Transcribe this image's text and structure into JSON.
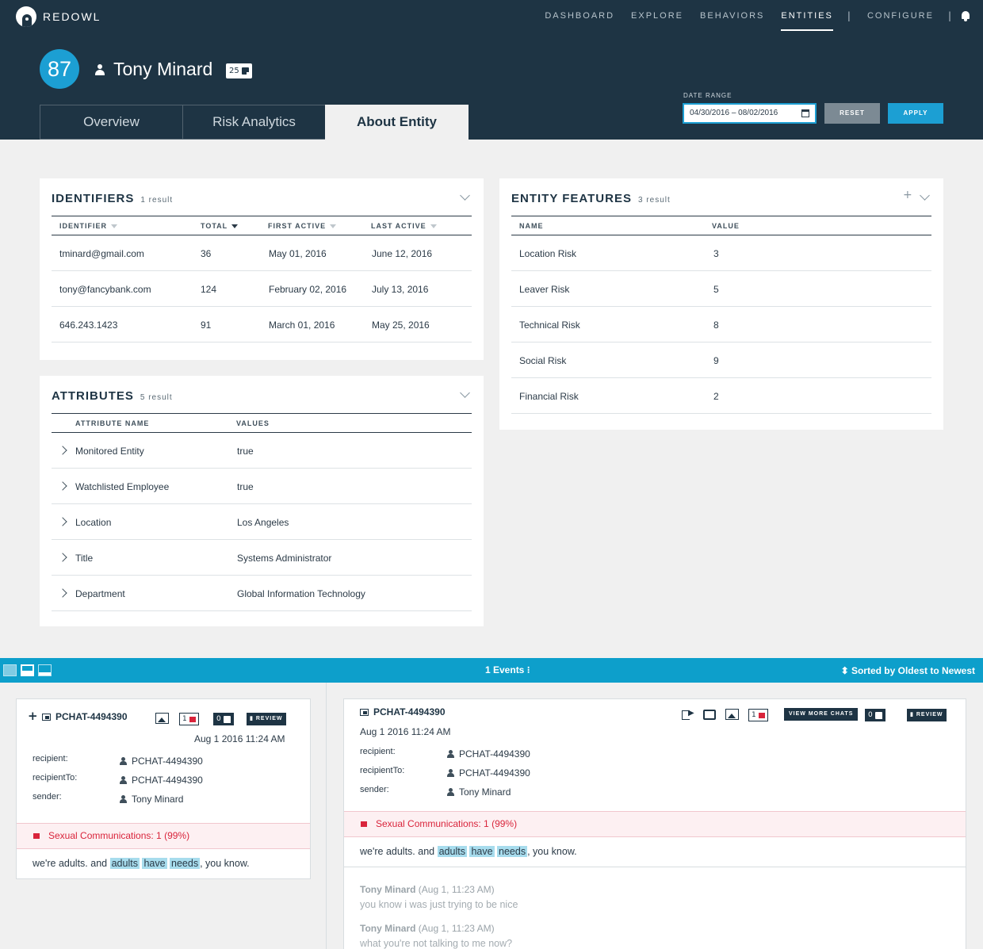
{
  "app": {
    "brand": "REDOWL"
  },
  "nav": {
    "items": [
      "DASHBOARD",
      "EXPLORE",
      "BEHAVIORS",
      "ENTITIES",
      "CONFIGURE"
    ],
    "active": "ENTITIES",
    "separator": "|"
  },
  "entity": {
    "score": "87",
    "name": "Tony Minard",
    "notes_count": "25"
  },
  "tabs": [
    "Overview",
    "Risk Analytics",
    "About Entity"
  ],
  "date_range": {
    "label": "DATE RANGE",
    "value": "04/30/2016 – 08/02/2016",
    "reset": "RESET",
    "apply": "APPLY"
  },
  "identifiers": {
    "title": "IDENTIFIERS",
    "count": "1 result",
    "columns": [
      "IDENTIFIER",
      "TOTAL",
      "FIRST ACTIVE",
      "LAST ACTIVE"
    ],
    "rows": [
      [
        "tminard@gmail.com",
        "36",
        "May 01, 2016",
        "June 12, 2016"
      ],
      [
        "tony@fancybank.com",
        "124",
        "February 02, 2016",
        "July 13, 2016"
      ],
      [
        "646.243.1423",
        "91",
        "March 01, 2016",
        "May 25, 2016"
      ]
    ]
  },
  "attributes": {
    "title": "ATTRIBUTES",
    "count": "5 result",
    "columns": [
      "ATTRIBUTE NAME",
      "VALUES"
    ],
    "rows": [
      [
        "Monitored Entity",
        "true"
      ],
      [
        "Watchlisted Employee",
        "true"
      ],
      [
        "Location",
        "Los Angeles"
      ],
      [
        "Title",
        "Systems Administrator"
      ],
      [
        "Department",
        "Global Information Technology"
      ]
    ]
  },
  "features": {
    "title": "ENTITY FEATURES",
    "count": "3 result",
    "columns": [
      "NAME",
      "VALUE"
    ],
    "rows": [
      [
        "Location Risk",
        "3"
      ],
      [
        "Leaver Risk",
        "5"
      ],
      [
        "Technical Risk",
        "8"
      ],
      [
        "Social Risk",
        "9"
      ],
      [
        "Financial Risk",
        "2"
      ]
    ]
  },
  "events": {
    "title": "1 Events ⁝",
    "sort": "⬍ Sorted by Oldest to Newest"
  },
  "event_card": {
    "id": "PCHAT-4494390",
    "flag_count": "1",
    "note_count": "0",
    "review": "REVIEW",
    "date": "Aug 1 2016  11:24 AM",
    "date_detail": "Aug 1 2016 11:24 AM",
    "view_more": "VIEW MORE CHATS",
    "meta": [
      {
        "label": "recipient:",
        "value": "PCHAT-4494390"
      },
      {
        "label": "recipientTo:",
        "value": "PCHAT-4494390"
      },
      {
        "label": "sender:",
        "value": "Tony Minard"
      }
    ],
    "flag_text": "Sexual Communications: 1 (99%)",
    "message": {
      "pre": "we're adults. and ",
      "h1": "adults",
      "h2": "have",
      "h3": "needs",
      "post": ", you know."
    }
  },
  "chat": [
    {
      "sender": "Tony Minard",
      "time": "(Aug 1, 11:23 AM)",
      "text": "you know i was just trying to be nice"
    },
    {
      "sender": "Tony Minard",
      "time": "(Aug 1, 11:23 AM)",
      "text": "what you're not talking to me now?"
    }
  ],
  "colors": {
    "header": "#1e3444",
    "accent": "#1c9fd3",
    "events_bar": "#0d9fcb",
    "flag": "#d9243b",
    "highlight": "#a7dced"
  }
}
